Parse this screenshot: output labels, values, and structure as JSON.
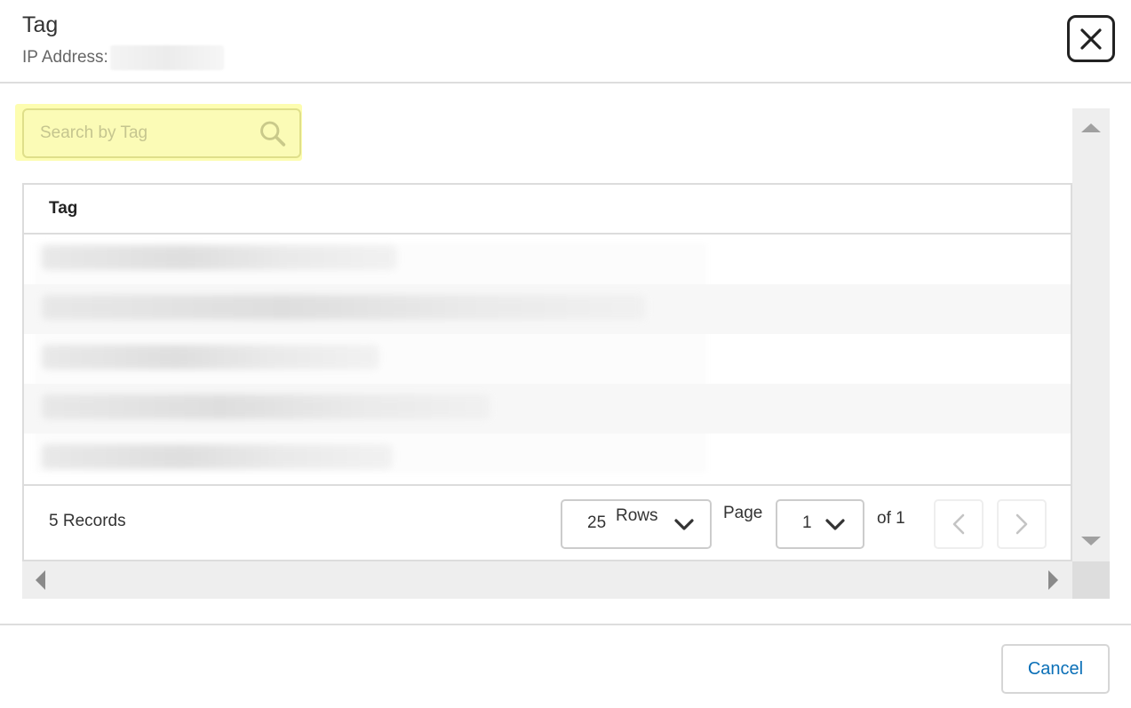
{
  "dialog": {
    "title": "Tag",
    "subtitle_label": "IP Address:",
    "close_icon": "close-icon"
  },
  "search": {
    "placeholder": "Search by Tag",
    "value": "",
    "icon": "search-icon",
    "highlight_color": "#fdfdb0"
  },
  "table": {
    "columns": [
      "Tag"
    ],
    "rows": [
      {
        "tag": "",
        "blurred": true
      },
      {
        "tag": "",
        "blurred": true
      },
      {
        "tag": "",
        "blurred": true
      },
      {
        "tag": "",
        "blurred": true
      },
      {
        "tag": "",
        "blurred": true
      }
    ]
  },
  "footer": {
    "records": "5 Records",
    "rows_value": "25",
    "rows_label": "Rows",
    "page_label": "Page",
    "page_value": "1",
    "of_label": "of 1",
    "prev_icon": "chevron-left-icon",
    "next_icon": "chevron-right-icon"
  },
  "actions": {
    "cancel_label": "Cancel",
    "cancel_color": "#0a6fb7"
  }
}
